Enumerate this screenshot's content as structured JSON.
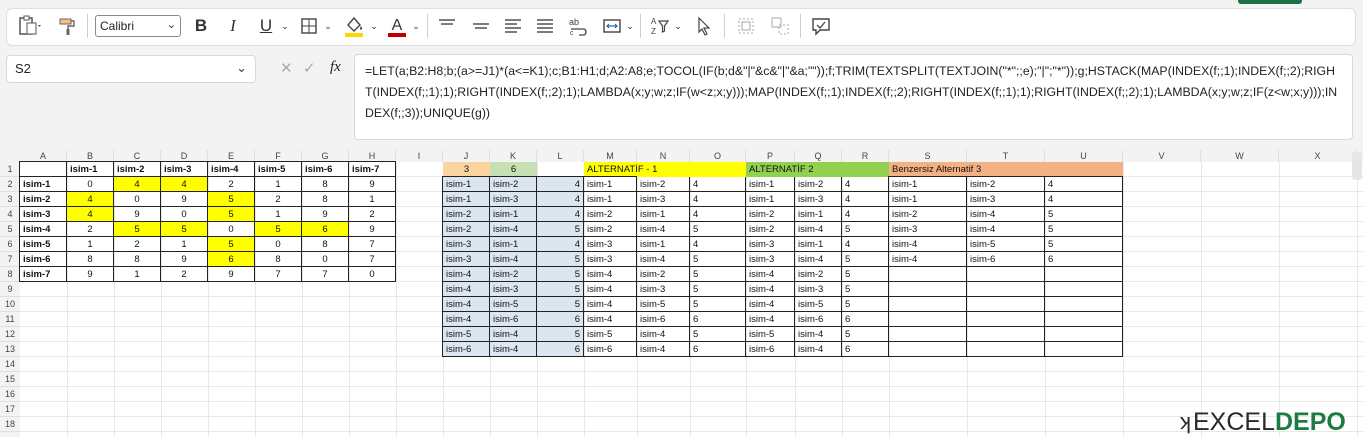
{
  "ribbon": {
    "font_name": "Calibri",
    "icons": [
      "paste-icon",
      "format-painter-icon",
      "bold-icon",
      "italic-icon",
      "underline-icon",
      "borders-icon",
      "fill-color-icon",
      "font-color-icon",
      "align-top-icon",
      "align-middle-icon",
      "align-left-icon",
      "align-justify-icon",
      "wrap-text-icon",
      "merge-icon",
      "filter-icon",
      "select-icon",
      "group-icon",
      "ungroup-icon",
      "comment-icon"
    ],
    "accent": "#1e7145",
    "fill_color": "#ffd700",
    "font_color": "#c00000"
  },
  "formula_bar": {
    "name_box": "S2",
    "fx_label": "fx",
    "formula": "=LET(a;B2:H8;b;(a>=J1)*(a<=K1);c;B1:H1;d;A2:A8;e;TOCOL(IF(b;d&\"|\"&c&\"|\"&a;\"\"));f;TRIM(TEXTSPLIT(TEXTJOIN(\"*\";;e);\"|\";\"*\"));g;HSTACK(MAP(INDEX(f;;1);INDEX(f;;2);RIGHT(INDEX(f;;1);1);RIGHT(INDEX(f;;2);1);LAMBDA(x;y;w;z;IF(w<z;x;y)));MAP(INDEX(f;;1);INDEX(f;;2);RIGHT(INDEX(f;;1);1);RIGHT(INDEX(f;;2);1);LAMBDA(x;y;w;z;IF(z<w;x;y)));INDEX(f;;3));UNIQUE(g))"
  },
  "columns": [
    "A",
    "B",
    "C",
    "D",
    "E",
    "F",
    "G",
    "H",
    "I",
    "J",
    "K",
    "L",
    "M",
    "N",
    "O",
    "P",
    "Q",
    "R",
    "S",
    "T",
    "U",
    "V",
    "W",
    "X"
  ],
  "rows": [
    "1",
    "2",
    "3",
    "4",
    "5",
    "6",
    "7",
    "8",
    "9",
    "10",
    "11",
    "12",
    "13",
    "14",
    "15",
    "16",
    "17",
    "18"
  ],
  "matrix": {
    "header": [
      "isim-1",
      "isim-2",
      "isim-3",
      "isim-4",
      "isim-5",
      "isim-6",
      "isim-7"
    ],
    "row_labels": [
      "isim-1",
      "isim-2",
      "isim-3",
      "isim-4",
      "isim-5",
      "isim-6",
      "isim-7"
    ],
    "values": [
      [
        "0",
        "4",
        "4",
        "2",
        "1",
        "8",
        "9"
      ],
      [
        "4",
        "0",
        "9",
        "5",
        "2",
        "8",
        "1"
      ],
      [
        "4",
        "9",
        "0",
        "5",
        "1",
        "9",
        "2"
      ],
      [
        "2",
        "5",
        "5",
        "0",
        "5",
        "6",
        "9"
      ],
      [
        "1",
        "2",
        "1",
        "5",
        "0",
        "8",
        "7"
      ],
      [
        "8",
        "8",
        "9",
        "6",
        "8",
        "0",
        "7"
      ],
      [
        "9",
        "1",
        "2",
        "9",
        "7",
        "7",
        "0"
      ]
    ],
    "highlighted": [
      [
        0,
        1
      ],
      [
        0,
        2
      ],
      [
        1,
        0
      ],
      [
        1,
        3
      ],
      [
        2,
        0
      ],
      [
        2,
        3
      ],
      [
        3,
        1
      ],
      [
        3,
        2
      ],
      [
        3,
        4
      ],
      [
        3,
        5
      ],
      [
        4,
        3
      ],
      [
        5,
        3
      ]
    ],
    "highlight_color": "#ffff00"
  },
  "criteria": {
    "min": "3",
    "max": "6",
    "min_color": "#fbd5a0",
    "max_color": "#c6e0b4"
  },
  "headers": {
    "alt1": "ALTERNATİF - 1",
    "alt1_color": "#ffff00",
    "alt2": "ALTERNATİF 2",
    "alt2_color": "#92d050",
    "alt3": "Benzersiz Alternatif 3",
    "alt3_color": "#f4b183"
  },
  "list_jkl": [
    [
      "isim-1",
      "isim-2",
      "4"
    ],
    [
      "isim-1",
      "isim-3",
      "4"
    ],
    [
      "isim-2",
      "isim-1",
      "4"
    ],
    [
      "isim-2",
      "isim-4",
      "5"
    ],
    [
      "isim-3",
      "isim-1",
      "4"
    ],
    [
      "isim-3",
      "isim-4",
      "5"
    ],
    [
      "isim-4",
      "isim-2",
      "5"
    ],
    [
      "isim-4",
      "isim-3",
      "5"
    ],
    [
      "isim-4",
      "isim-5",
      "5"
    ],
    [
      "isim-4",
      "isim-6",
      "6"
    ],
    [
      "isim-5",
      "isim-4",
      "5"
    ],
    [
      "isim-6",
      "isim-4",
      "6"
    ]
  ],
  "list_mno": [
    [
      "isim-1",
      "isim-2",
      "4"
    ],
    [
      "isim-1",
      "isim-3",
      "4"
    ],
    [
      "isim-2",
      "isim-1",
      "4"
    ],
    [
      "isim-2",
      "isim-4",
      "5"
    ],
    [
      "isim-3",
      "isim-1",
      "4"
    ],
    [
      "isim-3",
      "isim-4",
      "5"
    ],
    [
      "isim-4",
      "isim-2",
      "5"
    ],
    [
      "isim-4",
      "isim-3",
      "5"
    ],
    [
      "isim-4",
      "isim-5",
      "5"
    ],
    [
      "isim-4",
      "isim-6",
      "6"
    ],
    [
      "isim-5",
      "isim-4",
      "5"
    ],
    [
      "isim-6",
      "isim-4",
      "6"
    ]
  ],
  "list_pqr": [
    [
      "isim-1",
      "isim-2",
      "4"
    ],
    [
      "isim-1",
      "isim-3",
      "4"
    ],
    [
      "isim-2",
      "isim-1",
      "4"
    ],
    [
      "isim-2",
      "isim-4",
      "5"
    ],
    [
      "isim-3",
      "isim-1",
      "4"
    ],
    [
      "isim-3",
      "isim-4",
      "5"
    ],
    [
      "isim-4",
      "isim-2",
      "5"
    ],
    [
      "isim-4",
      "isim-3",
      "5"
    ],
    [
      "isim-4",
      "isim-5",
      "5"
    ],
    [
      "isim-4",
      "isim-6",
      "6"
    ],
    [
      "isim-5",
      "isim-4",
      "5"
    ],
    [
      "isim-6",
      "isim-4",
      "6"
    ]
  ],
  "list_stu": [
    [
      "isim-1",
      "isim-2",
      "4"
    ],
    [
      "isim-1",
      "isim-3",
      "4"
    ],
    [
      "isim-2",
      "isim-4",
      "5"
    ],
    [
      "isim-3",
      "isim-4",
      "5"
    ],
    [
      "isim-4",
      "isim-5",
      "5"
    ],
    [
      "isim-4",
      "isim-6",
      "6"
    ]
  ],
  "watermark": {
    "left": "EXCEL",
    "right": "DEPO"
  }
}
